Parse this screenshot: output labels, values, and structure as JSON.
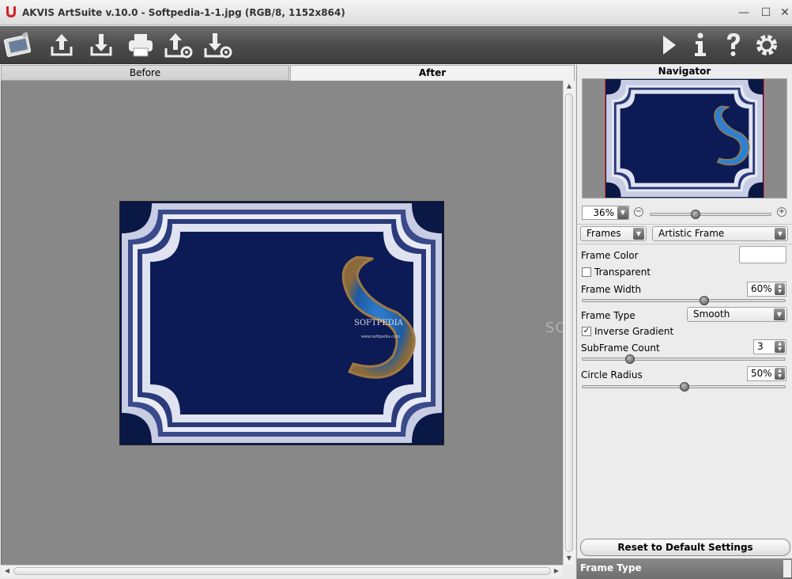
{
  "window": {
    "title": "AKVIS ArtSuite v.10.0 - Softpedia-1-1.jpg (RGB/8, 1152x864)",
    "minimize": "—",
    "maximize": "☐",
    "close": "✕"
  },
  "toolbar": {
    "left": [
      "home-icon",
      "open-icon",
      "save-icon",
      "print-icon",
      "share-icon",
      "plugin-settings-icon"
    ],
    "right": [
      "run-icon",
      "info-icon",
      "help-icon",
      "preferences-icon"
    ]
  },
  "tabs": {
    "before": "Before",
    "after": "After"
  },
  "image": {
    "brand": "SOFTPEDIA",
    "url": "www.softpedia.com"
  },
  "watermark": "SOFTPEDIA",
  "navigator": {
    "title": "Navigator",
    "zoom": "36%",
    "zoom_level": 0.36
  },
  "effect": {
    "category": "Frames",
    "frame": "Artistic Frame"
  },
  "settings": {
    "frame_color_label": "Frame Color",
    "frame_color": "#ffffff",
    "transparent_label": "Transparent",
    "transparent": false,
    "frame_width_label": "Frame Width",
    "frame_width": "60%",
    "frame_type_label": "Frame Type",
    "frame_type": "Smooth",
    "inverse_gradient_label": "Inverse Gradient",
    "inverse_gradient": true,
    "inverse_check": "✓",
    "subframe_count_label": "SubFrame Count",
    "subframe_count": "3",
    "circle_radius_label": "Circle Radius",
    "circle_radius": "50%"
  },
  "reset_label": "Reset to Default Settings",
  "hint_title": "Frame Type",
  "colors": {
    "frame_dark": "#0a1846",
    "frame_light": "#ffffff",
    "toolbar": "#4c4c4c",
    "canvas": "#888888"
  }
}
